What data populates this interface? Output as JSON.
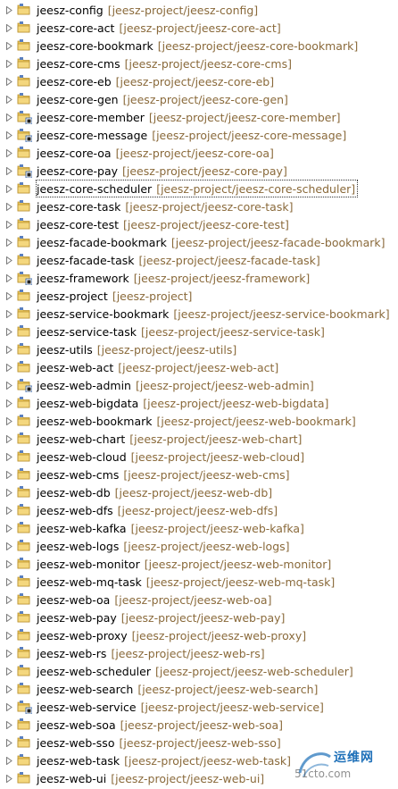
{
  "projects": [
    {
      "name": "jeesz-config",
      "path": "[jeesz-project/jeesz-config]",
      "badge": false
    },
    {
      "name": "jeesz-core-act",
      "path": "[jeesz-project/jeesz-core-act]",
      "badge": false
    },
    {
      "name": "jeesz-core-bookmark",
      "path": "[jeesz-project/jeesz-core-bookmark]",
      "badge": false
    },
    {
      "name": "jeesz-core-cms",
      "path": "[jeesz-project/jeesz-core-cms]",
      "badge": false
    },
    {
      "name": "jeesz-core-eb",
      "path": "[jeesz-project/jeesz-core-eb]",
      "badge": false
    },
    {
      "name": "jeesz-core-gen",
      "path": "[jeesz-project/jeesz-core-gen]",
      "badge": false
    },
    {
      "name": "jeesz-core-member",
      "path": "[jeesz-project/jeesz-core-member]",
      "badge": true
    },
    {
      "name": "jeesz-core-message",
      "path": "[jeesz-project/jeesz-core-message]",
      "badge": true
    },
    {
      "name": "jeesz-core-oa",
      "path": "[jeesz-project/jeesz-core-oa]",
      "badge": false
    },
    {
      "name": "jeesz-core-pay",
      "path": "[jeesz-project/jeesz-core-pay]",
      "badge": true
    },
    {
      "name": "jeesz-core-scheduler",
      "path": "[jeesz-project/jeesz-core-scheduler]",
      "badge": false,
      "selected": true
    },
    {
      "name": "jeesz-core-task",
      "path": "[jeesz-project/jeesz-core-task]",
      "badge": false
    },
    {
      "name": "jeesz-core-test",
      "path": "[jeesz-project/jeesz-core-test]",
      "badge": false
    },
    {
      "name": "jeesz-facade-bookmark",
      "path": "[jeesz-project/jeesz-facade-bookmark]",
      "badge": false
    },
    {
      "name": "jeesz-facade-task",
      "path": "[jeesz-project/jeesz-facade-task]",
      "badge": false
    },
    {
      "name": "jeesz-framework",
      "path": "[jeesz-project/jeesz-framework]",
      "badge": true
    },
    {
      "name": "jeesz-project",
      "path": "[jeesz-project]",
      "badge": false
    },
    {
      "name": "jeesz-service-bookmark",
      "path": "[jeesz-project/jeesz-service-bookmark]",
      "badge": false
    },
    {
      "name": "jeesz-service-task",
      "path": "[jeesz-project/jeesz-service-task]",
      "badge": false
    },
    {
      "name": "jeesz-utils",
      "path": "[jeesz-project/jeesz-utils]",
      "badge": false
    },
    {
      "name": "jeesz-web-act",
      "path": "[jeesz-project/jeesz-web-act]",
      "badge": false
    },
    {
      "name": "jeesz-web-admin",
      "path": "[jeesz-project/jeesz-web-admin]",
      "badge": true
    },
    {
      "name": "jeesz-web-bigdata",
      "path": "[jeesz-project/jeesz-web-bigdata]",
      "badge": false
    },
    {
      "name": "jeesz-web-bookmark",
      "path": "[jeesz-project/jeesz-web-bookmark]",
      "badge": false
    },
    {
      "name": "jeesz-web-chart",
      "path": "[jeesz-project/jeesz-web-chart]",
      "badge": false
    },
    {
      "name": "jeesz-web-cloud",
      "path": "[jeesz-project/jeesz-web-cloud]",
      "badge": false
    },
    {
      "name": "jeesz-web-cms",
      "path": "[jeesz-project/jeesz-web-cms]",
      "badge": false
    },
    {
      "name": "jeesz-web-db",
      "path": "[jeesz-project/jeesz-web-db]",
      "badge": false
    },
    {
      "name": "jeesz-web-dfs",
      "path": "[jeesz-project/jeesz-web-dfs]",
      "badge": false
    },
    {
      "name": "jeesz-web-kafka",
      "path": "[jeesz-project/jeesz-web-kafka]",
      "badge": false
    },
    {
      "name": "jeesz-web-logs",
      "path": "[jeesz-project/jeesz-web-logs]",
      "badge": false
    },
    {
      "name": "jeesz-web-monitor",
      "path": "[jeesz-project/jeesz-web-monitor]",
      "badge": false
    },
    {
      "name": "jeesz-web-mq-task",
      "path": "[jeesz-project/jeesz-web-mq-task]",
      "badge": false
    },
    {
      "name": "jeesz-web-oa",
      "path": "[jeesz-project/jeesz-web-oa]",
      "badge": false
    },
    {
      "name": "jeesz-web-pay",
      "path": "[jeesz-project/jeesz-web-pay]",
      "badge": false
    },
    {
      "name": "jeesz-web-proxy",
      "path": "[jeesz-project/jeesz-web-proxy]",
      "badge": false
    },
    {
      "name": "jeesz-web-rs",
      "path": "[jeesz-project/jeesz-web-rs]",
      "badge": false
    },
    {
      "name": "jeesz-web-scheduler",
      "path": "[jeesz-project/jeesz-web-scheduler]",
      "badge": false
    },
    {
      "name": "jeesz-web-search",
      "path": "[jeesz-project/jeesz-web-search]",
      "badge": false
    },
    {
      "name": "jeesz-web-service",
      "path": "[jeesz-project/jeesz-web-service]",
      "badge": true
    },
    {
      "name": "jeesz-web-soa",
      "path": "[jeesz-project/jeesz-web-soa]",
      "badge": false
    },
    {
      "name": "jeesz-web-sso",
      "path": "[jeesz-project/jeesz-web-sso]",
      "badge": false
    },
    {
      "name": "jeesz-web-task",
      "path": "[jeesz-project/jeesz-web-task]",
      "badge": false
    },
    {
      "name": "jeesz-web-ui",
      "path": "[jeesz-project/jeesz-web-ui]",
      "badge": false
    }
  ],
  "watermark": {
    "cn": "运维网",
    "en": "51cto.com"
  },
  "colors": {
    "folder": "#e8c45a",
    "folder_dark": "#b8902c",
    "path_text": "#8a6a3b",
    "badge": "#2a5aa0"
  }
}
